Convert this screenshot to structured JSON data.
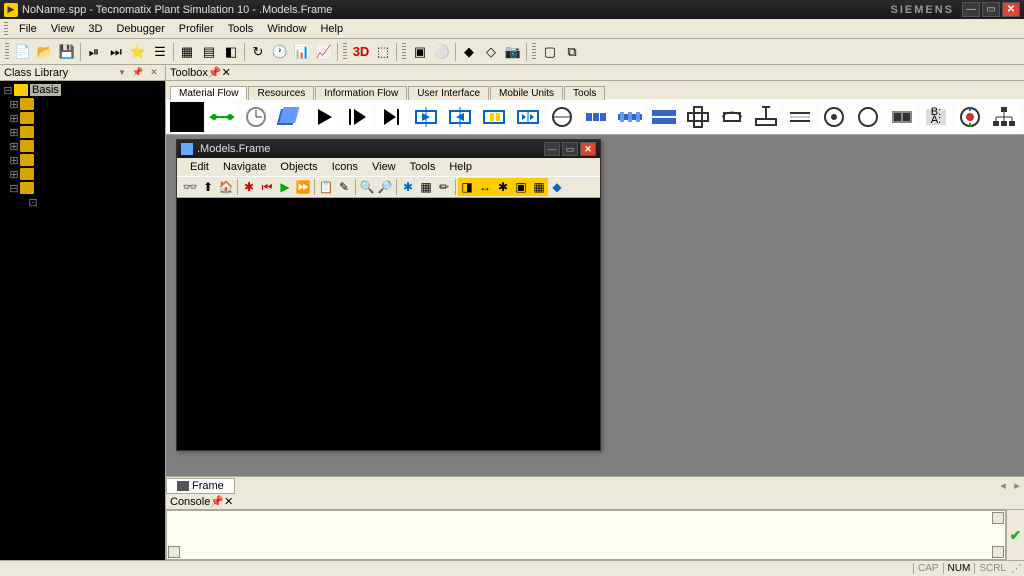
{
  "title": "NoName.spp - Tecnomatix Plant Simulation 10 - .Models.Frame",
  "brand": "SIEMENS",
  "main_menu": [
    "File",
    "View",
    "3D",
    "Debugger",
    "Profiler",
    "Tools",
    "Window",
    "Help"
  ],
  "class_library": {
    "title": "Class Library",
    "root": "Basis",
    "items": [
      "",
      "",
      "",
      "",
      "",
      "",
      "",
      ""
    ]
  },
  "toolbox": {
    "title": "Toolbox",
    "tabs": [
      "Material Flow",
      "Resources",
      "Information Flow",
      "User Interface",
      "Mobile Units",
      "Tools"
    ]
  },
  "subwindow": {
    "title": ".Models.Frame",
    "menu": [
      "Edit",
      "Navigate",
      "Objects",
      "Icons",
      "View",
      "Tools",
      "Help"
    ]
  },
  "frame_tab": "Frame",
  "console": {
    "title": "Console"
  },
  "status": {
    "cap": "CAP",
    "num": "NUM",
    "scrl": "SCRL"
  },
  "toolbar_text": {
    "threeD": "3D"
  }
}
